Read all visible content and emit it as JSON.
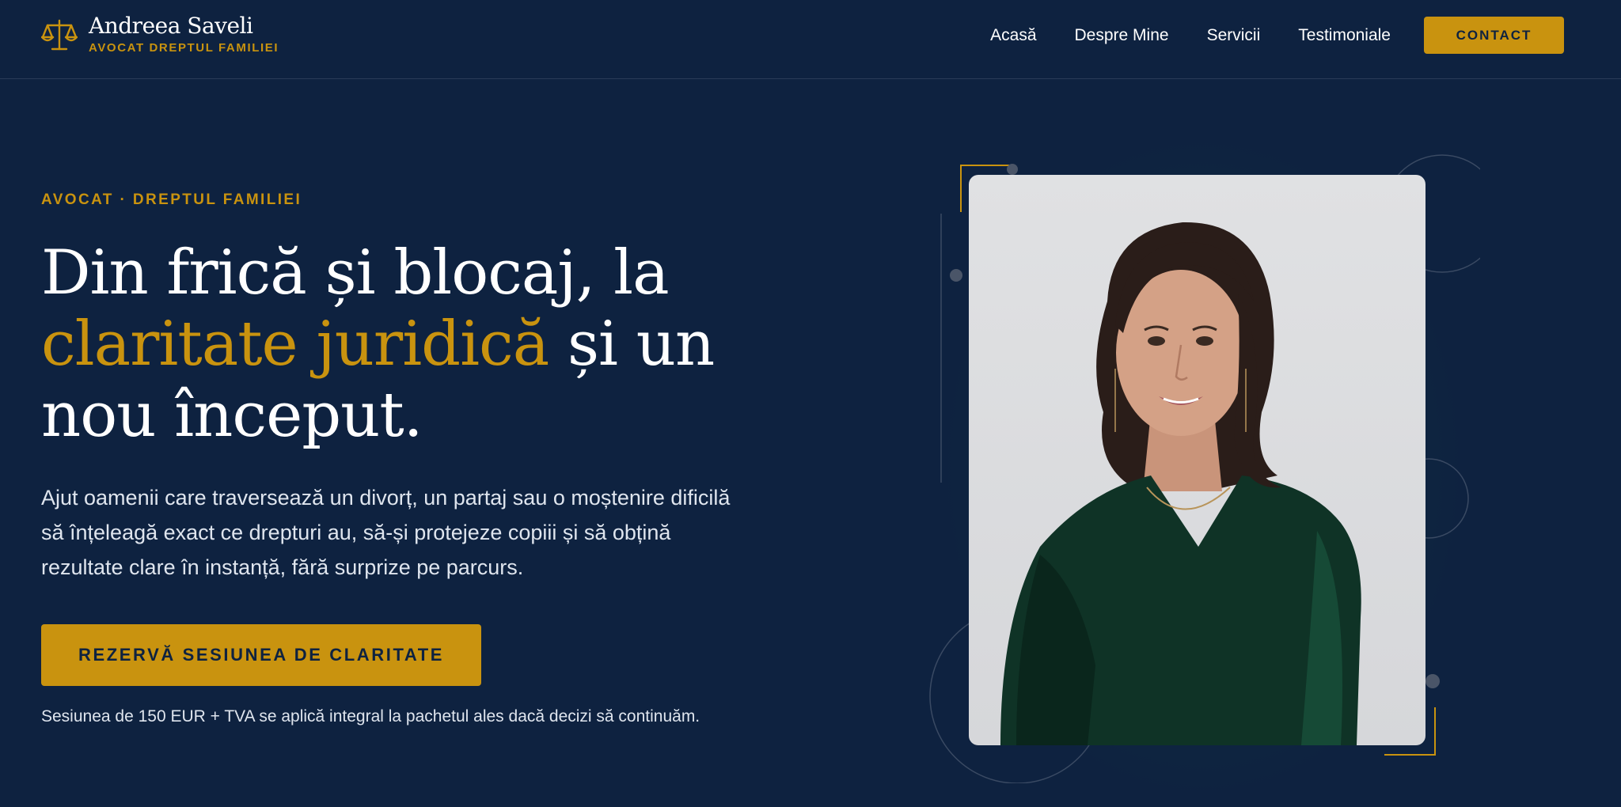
{
  "brand": {
    "name": "Andreea Saveli",
    "subtitle": "AVOCAT DREPTUL FAMILIEI",
    "logo_icon": "scales-of-justice-icon"
  },
  "nav": {
    "links": [
      "Acasă",
      "Despre Mine",
      "Servicii",
      "Testimoniale"
    ],
    "cta": "CONTACT"
  },
  "hero": {
    "eyebrow": "AVOCAT · DREPTUL FAMILIEI",
    "headline_part1": "Din frică și blocaj, la",
    "headline_accent": "claritate juridică",
    "headline_part2": "și un nou început.",
    "lead": "Ajut oamenii care traversează un divorț, un partaj sau o moștenire dificilă să înțeleagă exact ce drepturi au, să-și protejeze copiii și să obțină rezultate clare în instanță, fără surprize pe parcurs.",
    "cta": "REZERVĂ SESIUNEA DE CLARITATE",
    "note": "Sesiunea de 150 EUR + TVA se aplică integral la pachetul ales dacă decizi să continuăm."
  },
  "colors": {
    "background": "#0e2240",
    "accent": "#c9930f",
    "text": "#ffffff"
  }
}
